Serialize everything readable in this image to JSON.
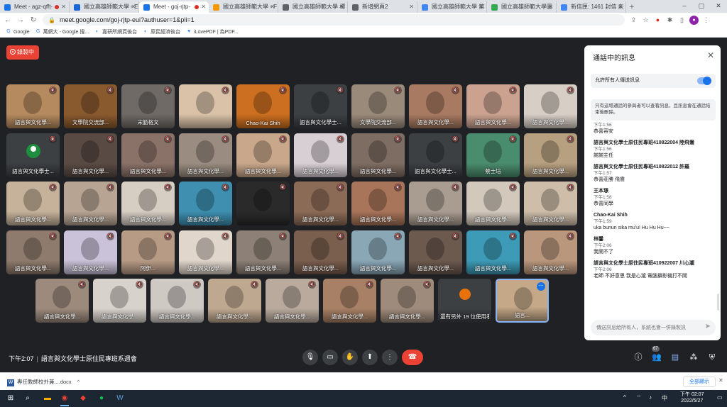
{
  "browser": {
    "tabs": [
      {
        "label": "Meet - agz-qfft-",
        "fav": "#1a73e8",
        "rec": true
      },
      {
        "label": "國立高雄師範大學 - E",
        "fav": "#1967d2"
      },
      {
        "label": "Meet - goj-rjtp-",
        "fav": "#1a73e8",
        "rec": true,
        "active": true
      },
      {
        "label": "國立高雄師範大學 - F",
        "fav": "#f29900"
      },
      {
        "label": "國立高雄師範大學 標",
        "fav": "#5f6368"
      },
      {
        "label": "新增網頁2",
        "fav": "#5f6368"
      },
      {
        "label": "國立高雄師範大學 第",
        "fav": "#4285f4"
      },
      {
        "label": "國立高雄師範大學圖",
        "fav": "#34a853"
      },
      {
        "label": "新信匣: 1461 封信 未",
        "fav": "#4285f4"
      }
    ],
    "url": "meet.google.com/goj-rjtp-eui?authuser=1&pli=1",
    "bookmarks": [
      "Google",
      "萬網大 - Google 搜...",
      "嘉研所網頁後台",
      "原民經濟後台",
      "iLovePDF | 為PDF..."
    ]
  },
  "meet": {
    "recording_label": "錄製中",
    "time": "下午2:07",
    "meeting_title": "語言與文化學士原住民專班系週會",
    "participants_count": "67",
    "tiles": [
      {
        "name": "語言與文化學...",
        "bg": "#b58a5e"
      },
      {
        "name": "文學院交流部...",
        "bg": "#8a5a2f"
      },
      {
        "name": "宋勤格文",
        "bg": "#6f6a66"
      },
      {
        "name": "",
        "bg": "#d9c2a8"
      },
      {
        "name": "Chao-Kai Shih",
        "bg": "#cc6f20"
      },
      {
        "name": "語言與文化學士...",
        "bg": "#3c4043"
      },
      {
        "name": "文學院交流部...",
        "bg": "#9a8a7a"
      },
      {
        "name": "語言與文化學...",
        "bg": "#a87a62"
      },
      {
        "name": "語言與文化學...",
        "bg": "#caa28f"
      },
      {
        "name": "語言與文化學...",
        "bg": "#d7cfc6"
      },
      {
        "name": "語言與文化學士...",
        "bg": "#3c4043",
        "avatar": true
      },
      {
        "name": "語言與文化學...",
        "bg": "#5a4a44"
      },
      {
        "name": "語言與文化學...",
        "bg": "#8a7268"
      },
      {
        "name": "語言與文化學...",
        "bg": "#9a8c80"
      },
      {
        "name": "語言與文化學...",
        "bg": "#c9a78a"
      },
      {
        "name": "語言與文化學...",
        "bg": "#d8cfd4"
      },
      {
        "name": "語言與文化學...",
        "bg": "#7e6d62"
      },
      {
        "name": "語言與文化學士...",
        "bg": "#3c4043"
      },
      {
        "name": "蔡士培",
        "bg": "#4a8c6e"
      },
      {
        "name": "語言與文化學...",
        "bg": "#b7a080"
      },
      {
        "name": "語言與文化學...",
        "bg": "#c6b29a"
      },
      {
        "name": "語言與文化學...",
        "bg": "#b7a493"
      },
      {
        "name": "語言與文化學...",
        "bg": "#d6cdc3"
      },
      {
        "name": "語言與文化學...",
        "bg": "#3e8fb0"
      },
      {
        "name": "",
        "bg": "#2a2a2a"
      },
      {
        "name": "語言與文化學...",
        "bg": "#8c6b56"
      },
      {
        "name": "語言與文化學...",
        "bg": "#a8745a"
      },
      {
        "name": "語言與文化學...",
        "bg": "#a99c90"
      },
      {
        "name": "語言與文化學...",
        "bg": "#d2c8bc"
      },
      {
        "name": "語言與文化學...",
        "bg": "#cdbda9"
      },
      {
        "name": "語言與文化學...",
        "bg": "#8f7b6d"
      },
      {
        "name": "語言與文化學...",
        "bg": "#c9c2d8"
      },
      {
        "name": "阿伊...",
        "bg": "#b89b85"
      },
      {
        "name": "語言與文化學...",
        "bg": "#e0d6cb"
      },
      {
        "name": "語言與文化學...",
        "bg": "#8d8076"
      },
      {
        "name": "語言與文化學...",
        "bg": "#7a5e4e"
      },
      {
        "name": "語言與文化學...",
        "bg": "#8aa7b6"
      },
      {
        "name": "語言與文化學...",
        "bg": "#6d5a4f"
      },
      {
        "name": "語言與文化學...",
        "bg": "#3d9bb7"
      },
      {
        "name": "語言與文化學...",
        "bg": "#b9977c"
      },
      {
        "name": "語言與文化學...",
        "bg": "#9c8a7c"
      },
      {
        "name": "語言與文化學...",
        "bg": "#d8d2cc"
      },
      {
        "name": "語言與文化學...",
        "bg": "#cfc9c4"
      },
      {
        "name": "語言與文化學...",
        "bg": "#bfa890"
      },
      {
        "name": "語言與文化學...",
        "bg": "#b9aa9d"
      },
      {
        "name": "語言與文化學...",
        "bg": "#a78065"
      },
      {
        "name": "語言與文化學...",
        "bg": "#9e8b7b"
      },
      {
        "name": "還有另外 19 位使用者",
        "bg": "#3c4043",
        "others": true
      },
      {
        "name": "語言...",
        "bg": "#c4a888",
        "selected": true
      }
    ]
  },
  "chat": {
    "title": "通話中的訊息",
    "allow_label": "允許所有人傳送訊息",
    "notice": "只有這場通話的參與者可以查看訊息，且訊息會在通話結束後刪除。",
    "messages": [
      {
        "who": "",
        "time": "下午1:56",
        "text": "恭喜容安"
      },
      {
        "who": "語言與文化學士原住民專班410822004 陸飛鴦",
        "time": "下午1:56",
        "text": "謝謝主任"
      },
      {
        "who": "語言與文化學士原住民專班410822012 許羅",
        "time": "下午1:57",
        "text": "恭喜莊勝 飛鴦"
      },
      {
        "who": "王本璟",
        "time": "下午1:58",
        "text": "恭喜同學"
      },
      {
        "who": "Chao-Kai Shih",
        "time": "下午1:59",
        "text": "uka bunun sika mu'u! Hu Hu Hu~~"
      },
      {
        "who": "林馨",
        "time": "下午2:06",
        "text": "我開不了"
      },
      {
        "who": "語言與文化學士原住民專班410922007 川心瀧",
        "time": "下午2:06",
        "text": "老師 不好意思 我是心瀧 電腦攝影機打不開"
      }
    ],
    "input_placeholder": "傳送訊息給所有人，系統也會一併錄製訊"
  },
  "downloads": {
    "file": "專任教師校外兼....docx",
    "show_all": "全部顯示"
  },
  "taskbar": {
    "time": "下午 02:07",
    "date": "2022/5/27"
  },
  "colors": {
    "meet_bg": "#202124",
    "recording": "#ea4335",
    "accent": "#1a73e8"
  }
}
